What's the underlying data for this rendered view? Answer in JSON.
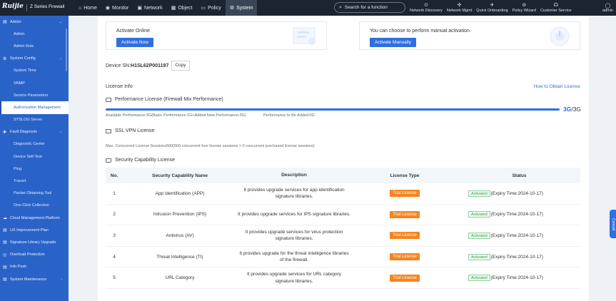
{
  "app": {
    "logo": "Ruijie",
    "product": "Z Series Firewall"
  },
  "nav": [
    {
      "label": "Home",
      "icon": "home-icon",
      "glyph": "⌂"
    },
    {
      "label": "Monitor",
      "icon": "monitor-icon",
      "glyph": "◉"
    },
    {
      "label": "Network",
      "icon": "network-icon",
      "glyph": "▣"
    },
    {
      "label": "Object",
      "icon": "object-icon",
      "glyph": "▦"
    },
    {
      "label": "Policy",
      "icon": "policy-icon",
      "glyph": "▭"
    },
    {
      "label": "System",
      "icon": "system-icon",
      "glyph": "⚙"
    }
  ],
  "search": {
    "placeholder": "Search for a function"
  },
  "tools": [
    {
      "label": "Network Discovery",
      "icon": "network-discovery-icon",
      "glyph": "⊙"
    },
    {
      "label": "Network Mgmt",
      "icon": "network-mgmt-icon",
      "glyph": "✣"
    },
    {
      "label": "Quick Onboarding",
      "icon": "quick-onboarding-icon",
      "glyph": "✈"
    },
    {
      "label": "Policy Wizard",
      "icon": "policy-wizard-icon",
      "glyph": "⊘"
    },
    {
      "label": "Customer Service",
      "icon": "headset-icon",
      "glyph": "☊"
    }
  ],
  "user": {
    "name": "admin",
    "glyph": "◯"
  },
  "sidebar": {
    "groups": [
      {
        "label": "Admin",
        "icon": "admin-icon",
        "glyph": "▤",
        "items": [
          "Admin",
          "Admin Role"
        ]
      },
      {
        "label": "System Config",
        "icon": "system-config-icon",
        "glyph": "⚙",
        "items": [
          "System Time",
          "SNMP",
          "Service Parameters",
          "Authorization Management",
          "SYSLOG Server"
        ]
      },
      {
        "label": "Fault Diagnosis",
        "icon": "fault-diagnosis-icon",
        "glyph": "✚",
        "items": [
          "Diagnostic Center",
          "Device Self-Test",
          "Ping",
          "Tracert",
          "Packet Obtaining Tool",
          "One-Click Collection"
        ]
      },
      {
        "label": "Cloud Management Platform",
        "icon": "cloud-icon",
        "glyph": "☁",
        "items": []
      },
      {
        "label": "UX Improvement Plan",
        "icon": "ux-icon",
        "glyph": "▤",
        "items": []
      },
      {
        "label": "Signature Library Upgrade",
        "icon": "signature-icon",
        "glyph": "▤",
        "items": []
      },
      {
        "label": "Overload Protection",
        "icon": "overload-icon",
        "glyph": "◎",
        "items": []
      },
      {
        "label": "Info Push",
        "icon": "info-push-icon",
        "glyph": "▤",
        "items": []
      },
      {
        "label": "System Maintenance",
        "icon": "maintenance-icon",
        "glyph": "▤",
        "items": []
      }
    ],
    "active": "Authorization Management"
  },
  "activation": {
    "online_title": "Activate Online",
    "online_button": "Activate Now",
    "manual_title": "You can choose to perform manual activation.",
    "manual_button": "Activate Manually"
  },
  "device": {
    "sn_label": "Device SN:",
    "sn_value": "H1SL62P001197",
    "copy": "Copy"
  },
  "license_info": {
    "title": "License Info",
    "obtain_link": "How to Obtain License",
    "performance": {
      "title": "Performance License (Firewall Mix Performance)",
      "value": "3G",
      "total": "/3G",
      "fill_percent": 100,
      "available": "Available Performance:3G(Basic Performance:1G+Added New Performance:2G)",
      "to_be_added": "Performance to Be Added:0G"
    },
    "ssl_vpn": {
      "title": "SSL VPN License",
      "note": "Max. Concurrent License Sessions500(500 concurrent free license sessions + 0 concurrent purchased license sessions)"
    },
    "security": {
      "title": "Security Capability License",
      "columns": [
        "No.",
        "Security Capability Name",
        "Description",
        "License Type",
        "Status"
      ],
      "rows": [
        {
          "no": "1",
          "name": "App Identification (APP)",
          "desc": "It provides upgrade services for app identification signature libraries.",
          "type": "Trial License",
          "status": "Activated",
          "expiry": "(Expiry Time:2024-10-17)"
        },
        {
          "no": "2",
          "name": "Intrusion Prevention (IPS)",
          "desc": "It provides upgrade services for IPS signature libraries.",
          "type": "Trial License",
          "status": "Activated",
          "expiry": "(Expiry Time:2024-10-17)"
        },
        {
          "no": "3",
          "name": "Antivirus (AV)",
          "desc": "It provides upgrade services for virus protection signature libraries.",
          "type": "Trial License",
          "status": "Activated",
          "expiry": "(Expiry Time:2024-10-17)"
        },
        {
          "no": "4",
          "name": "Threat Intelligence (TI)",
          "desc": "It provides upgrade for the threat intelligence libraries of the firewall.",
          "type": "Trial License",
          "status": "Activated",
          "expiry": "(Expiry Time:2024-10-17)"
        },
        {
          "no": "5",
          "name": "URL Category",
          "desc": "It provides upgrade services for URL category signature libraries.",
          "type": "Trial License",
          "status": "Activated",
          "expiry": "(Expiry Time:2024-10-17)"
        }
      ]
    }
  },
  "float_tab": "Consult"
}
